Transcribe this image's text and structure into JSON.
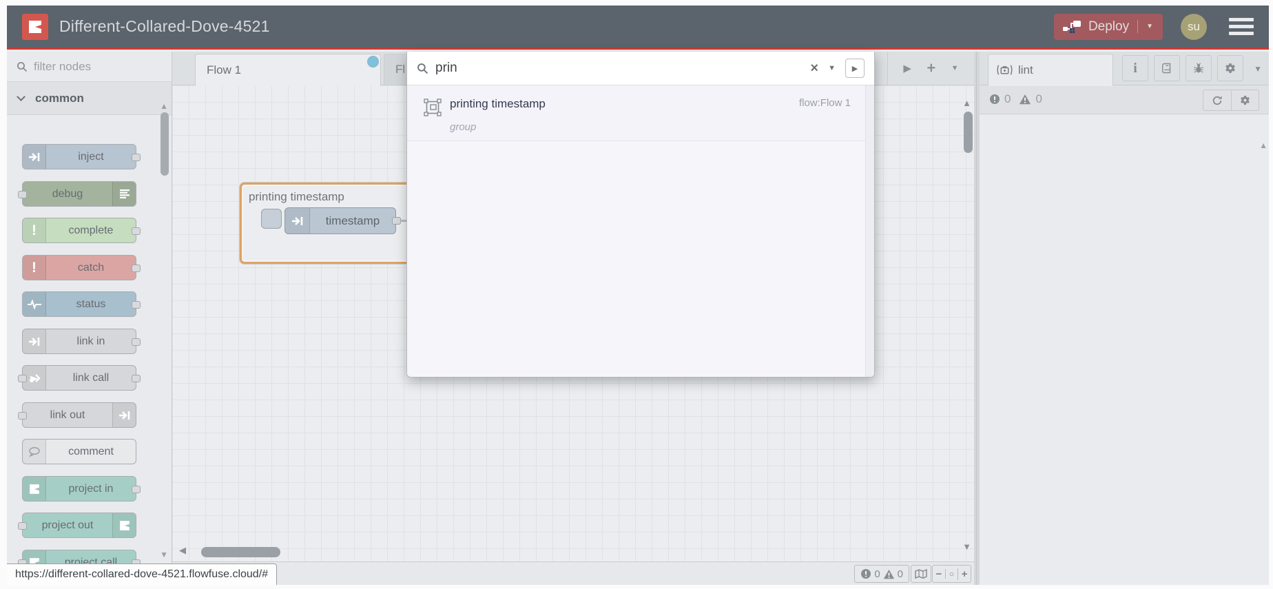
{
  "header": {
    "title": "Different-Collared-Dove-4521",
    "deploy_label": "Deploy",
    "avatar_initials": "su"
  },
  "palette": {
    "filter_placeholder": "filter nodes",
    "category_label": "common",
    "nodes": [
      {
        "label": "inject"
      },
      {
        "label": "debug"
      },
      {
        "label": "complete"
      },
      {
        "label": "catch"
      },
      {
        "label": "status"
      },
      {
        "label": "link in"
      },
      {
        "label": "link call"
      },
      {
        "label": "link out"
      },
      {
        "label": "comment"
      },
      {
        "label": "project in"
      },
      {
        "label": "project out"
      },
      {
        "label": "project call"
      }
    ]
  },
  "workspace": {
    "tab1_label": "Flow 1",
    "tab2_label": "Fl",
    "group_label": "printing timestamp",
    "node_label": "timestamp"
  },
  "search": {
    "query": "prin",
    "result_title": "printing timestamp",
    "result_type": "group",
    "result_flow": "flow:Flow 1"
  },
  "sidebar": {
    "tab_label": "lint",
    "error_count": "0",
    "warning_count": "0"
  },
  "canvas_footer": {
    "error_count": "0",
    "warning_count": "0"
  },
  "statusbar": {
    "url": "https://different-collared-dove-4521.flowfuse.cloud/#"
  },
  "icons": {
    "clear": "×",
    "dropdown": "▼",
    "open_panel": "▶",
    "scroll_up": "▲",
    "scroll_down": "▼",
    "scroll_left": "◀",
    "tab_scroll_right": "▶",
    "add": "+",
    "zoom_out": "−",
    "zoom_reset": "○",
    "zoom_in": "+",
    "info": "i"
  },
  "colors": {
    "header_bg": "#5b636c",
    "accent_red": "#cc3a34",
    "logo_red": "#d4574f",
    "deploy_bg": "#a25a5f",
    "avatar_bg": "#a7a176",
    "group_border": "#dfa263",
    "modified_dot": "#7fc0dc",
    "inject_node": "#b7c4d1",
    "debug_node": "#a3b39d",
    "complete_node": "#c6ddc0",
    "catch_node": "#dba5a3",
    "status_node": "#a8bfcd",
    "link_node": "#d5d7da",
    "comment_node": "#e7e9eb",
    "project_node": "#a5cfc6"
  }
}
